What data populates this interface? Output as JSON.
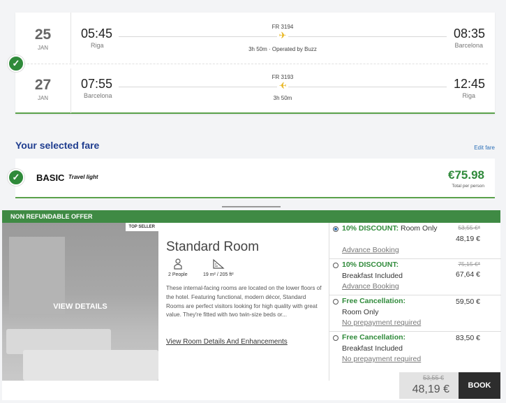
{
  "flight": {
    "outbound": {
      "day": "25",
      "month": "JAN",
      "dep_time": "05:45",
      "dep_city": "Riga",
      "flight_no": "FR 3194",
      "info": "3h 50m · Operated by Buzz",
      "arr_time": "08:35",
      "arr_city": "Barcelona"
    },
    "return": {
      "day": "27",
      "month": "JAN",
      "dep_time": "07:55",
      "dep_city": "Barcelona",
      "flight_no": "FR 3193",
      "info": "3h 50m",
      "arr_time": "12:45",
      "arr_city": "Riga"
    }
  },
  "fare": {
    "section_title": "Your selected fare",
    "edit_label": "Edit fare",
    "name": "BASIC",
    "subtitle": "Travel light",
    "price": "€75.98",
    "price_note": "Total per person"
  },
  "offer": {
    "header": "NON REFUNDABLE OFFER",
    "badge": "TOP SELLER",
    "view_details": "VIEW DETAILS",
    "room_title": "Standard Room",
    "amenities": [
      {
        "icon": "person-icon",
        "label": "2 People"
      },
      {
        "icon": "room-size-icon",
        "label": "19 m² / 205 ft²"
      }
    ],
    "description": "These internal-facing rooms are located on the lower floors of the hotel. Featuring functional, modern décor, Standard Rooms are perfect visitors looking for high quality with great value. They're fitted with two twin-size beds or...",
    "details_link": "View Room Details And Enhancements",
    "options": [
      {
        "title": "10% DISCOUNT:",
        "subtitle": " Room Only",
        "link": "Advance Booking",
        "old_price": "53,55 €*",
        "price": "48,19 €",
        "selected": true
      },
      {
        "title": "10% DISCOUNT:",
        "subtitle": "Breakfast Included",
        "link": "Advance Booking",
        "old_price": "75,15 €*",
        "price": "67,64 €",
        "selected": false
      },
      {
        "title": "Free Cancellation:",
        "subtitle": "Room Only",
        "link": "No prepayment required",
        "old_price": "",
        "price": "59,50 €",
        "selected": false
      },
      {
        "title": "Free Cancellation:",
        "subtitle": "Breakfast Included",
        "link": "No prepayment required",
        "old_price": "",
        "price": "83,50 €",
        "selected": false
      }
    ],
    "total_old": "53,55 €",
    "total_new": "48,19 €",
    "book_label": "BOOK"
  },
  "colors": {
    "accent_green": "#3f8a44",
    "brand_blue": "#1f3d8f",
    "plane_yellow": "#e7b318"
  }
}
